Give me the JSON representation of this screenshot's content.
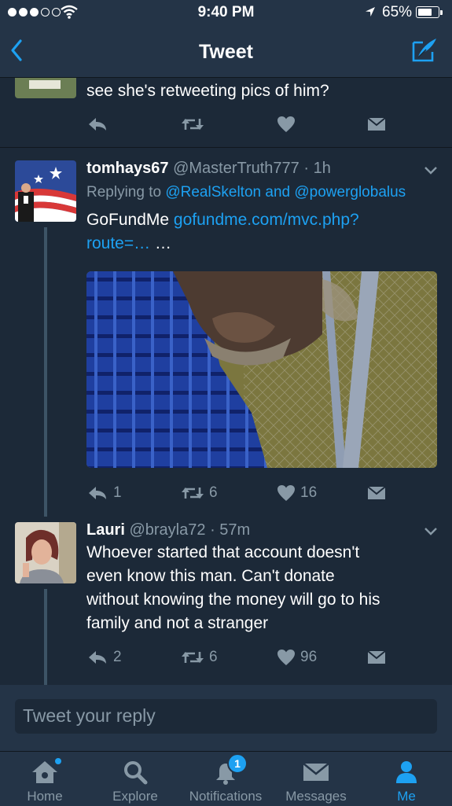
{
  "status_bar": {
    "time": "9:40 PM",
    "battery": "65%",
    "battery_level": 0.65,
    "signal_bars_filled": 3,
    "signal_bars_total": 5
  },
  "nav": {
    "title": "Tweet",
    "back_icon": "chevron-left-icon",
    "compose_icon": "compose-tweet-icon"
  },
  "tweet_partial": {
    "text": "see she's retweeting pics of him?"
  },
  "tweet1": {
    "name": "tomhays67",
    "handle": "@MasterTruth777",
    "separator": "·",
    "time": "1h",
    "replying_prefix": "Replying to",
    "replying_mention1": "@RealSkelton",
    "replying_and": "and",
    "replying_mention2": "@powerglobalus",
    "text_prefix": "GoFundMe",
    "link_line1": "gofundme.com/mvc.php?",
    "link_line2": "route=…",
    "text_suffix": "…",
    "replies": "1",
    "retweets": "6",
    "likes": "16"
  },
  "tweet2": {
    "name": "Lauri",
    "handle": "@brayla72",
    "separator": "·",
    "time": "57m",
    "text_line1": "Whoever started that account doesn't",
    "text_line2": "even know this man. Can't donate",
    "text_line3": "without knowing the money will go to his",
    "text_line4": "family and not a stranger",
    "replies": "2",
    "retweets": "6",
    "likes": "96"
  },
  "reply_box": {
    "placeholder": "Tweet your reply"
  },
  "tabs": [
    {
      "label": "Home",
      "icon": "home-icon"
    },
    {
      "label": "Explore",
      "icon": "search-icon"
    },
    {
      "label": "Notifications",
      "icon": "bell-icon",
      "badge": "1"
    },
    {
      "label": "Messages",
      "icon": "envelope-icon"
    },
    {
      "label": "Me",
      "icon": "person-icon"
    }
  ],
  "colors": {
    "background": "#1c2938",
    "bar": "#243447",
    "accent": "#1da1f2",
    "muted": "#8899a6"
  }
}
